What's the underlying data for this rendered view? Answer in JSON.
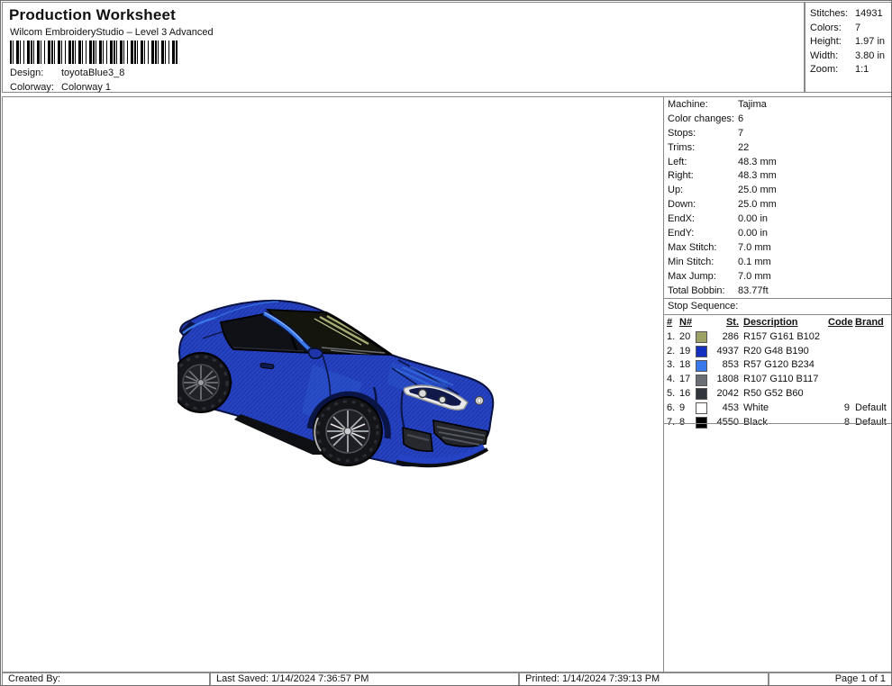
{
  "header": {
    "title": "Production Worksheet",
    "subtitle": "Wilcom EmbroideryStudio – Level 3 Advanced",
    "design_label": "Design:",
    "design_value": "toyotaBlue3_8",
    "colorway_label": "Colorway:",
    "colorway_value": "Colorway 1",
    "stats": [
      {
        "label": "Stitches:",
        "value": "14931"
      },
      {
        "label": "Colors:",
        "value": "7"
      },
      {
        "label": "Height:",
        "value": "1.97 in"
      },
      {
        "label": "Width:",
        "value": "3.80 in"
      },
      {
        "label": "Zoom:",
        "value": "1:1"
      }
    ]
  },
  "machine_info": {
    "rows": [
      {
        "label": "Machine:",
        "value": "Tajima"
      },
      {
        "label": "Color changes:",
        "value": "6"
      },
      {
        "label": "Stops:",
        "value": "7"
      },
      {
        "label": "Trims:",
        "value": "22"
      },
      {
        "label": "Left:",
        "value": "48.3 mm"
      },
      {
        "label": "Right:",
        "value": "48.3 mm"
      },
      {
        "label": "Up:",
        "value": "25.0 mm"
      },
      {
        "label": "Down:",
        "value": "25.0 mm"
      },
      {
        "label": "EndX:",
        "value": "0.00 in"
      },
      {
        "label": "EndY:",
        "value": "0.00 in"
      },
      {
        "label": "Max Stitch:",
        "value": "7.0 mm"
      },
      {
        "label": "Min Stitch:",
        "value": "0.1 mm"
      },
      {
        "label": "Max Jump:",
        "value": "7.0 mm"
      },
      {
        "label": "Total Bobbin:",
        "value": "83.77ft"
      }
    ]
  },
  "stop_sequence": {
    "title": "Stop Sequence:",
    "headers": {
      "num": "#",
      "n": "N#",
      "st": "St.",
      "description": "Description",
      "code": "Code",
      "brand": "Brand"
    },
    "rows": [
      {
        "num": "1.",
        "n": "20",
        "color": "#9DA166",
        "st": "286",
        "description": "R157 G161 B102",
        "code": "",
        "brand": ""
      },
      {
        "num": "2.",
        "n": "19",
        "color": "#1430BE",
        "st": "4937",
        "description": "R20 G48 B190",
        "code": "",
        "brand": ""
      },
      {
        "num": "3.",
        "n": "18",
        "color": "#3978EA",
        "st": "853",
        "description": "R57 G120 B234",
        "code": "",
        "brand": ""
      },
      {
        "num": "4.",
        "n": "17",
        "color": "#6B6E75",
        "st": "1808",
        "description": "R107 G110 B117",
        "code": "",
        "brand": ""
      },
      {
        "num": "5.",
        "n": "16",
        "color": "#32343C",
        "st": "2042",
        "description": "R50 G52 B60",
        "code": "",
        "brand": ""
      },
      {
        "num": "6.",
        "n": "9",
        "color": "#FFFFFF",
        "st": "453",
        "description": "White",
        "code": "9",
        "brand": "Default"
      },
      {
        "num": "7.",
        "n": "8",
        "color": "#000000",
        "st": "4550",
        "description": "Black",
        "code": "8",
        "brand": "Default"
      }
    ]
  },
  "footer": {
    "created_by": "Created By:",
    "last_saved": "Last Saved: 1/14/2024 7:36:57 PM",
    "printed": "Printed: 1/14/2024 7:39:13 PM",
    "page": "Page 1 of 1"
  },
  "design_preview": {
    "alt": "Blue Toyota coupe embroidery stitch-out, front three-quarter view",
    "palette": {
      "body_blue": "#1430BE",
      "highlight_blue": "#3978EA",
      "olive": "#9DA166",
      "gray": "#6B6E75",
      "dark_gray": "#32343C",
      "white": "#FFFFFF",
      "black": "#000000"
    }
  }
}
